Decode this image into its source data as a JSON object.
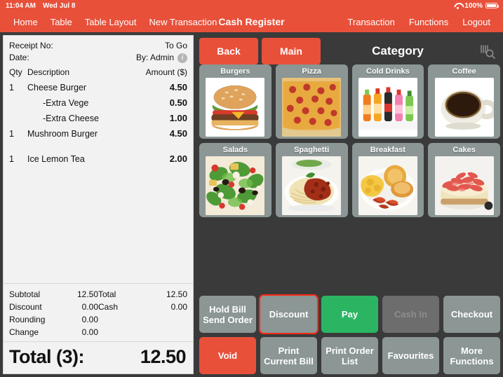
{
  "statusbar": {
    "time": "11:04 AM",
    "date": "Wed Jul 8",
    "battery_pct": "100%",
    "wifi_icon": "wifi-icon",
    "battery_icon": "battery-icon"
  },
  "navbar": {
    "left_items": [
      "Home",
      "Table",
      "Table Layout",
      "New Transaction"
    ],
    "title": "Cash Register",
    "right_items": [
      "Transaction",
      "Functions",
      "Logout"
    ]
  },
  "receipt": {
    "receipt_no_label": "Receipt No:",
    "receipt_no_value": "To Go",
    "date_label": "Date:",
    "date_value": "By: Admin",
    "info_icon": "info-icon",
    "col_qty": "Qty",
    "col_desc": "Description",
    "col_amount": "Amount ($)",
    "items": [
      {
        "qty": "1",
        "desc": "Cheese Burger",
        "amt": "4.50",
        "modifier": false,
        "spacer_after": false
      },
      {
        "qty": "",
        "desc": "-Extra Vege",
        "amt": "0.50",
        "modifier": true,
        "spacer_after": false
      },
      {
        "qty": "",
        "desc": "-Extra Cheese",
        "amt": "1.00",
        "modifier": true,
        "spacer_after": false
      },
      {
        "qty": "1",
        "desc": "Mushroom Burger",
        "amt": "4.50",
        "modifier": false,
        "spacer_after": true
      },
      {
        "qty": "1",
        "desc": "Ice Lemon Tea",
        "amt": "2.00",
        "modifier": false,
        "spacer_after": false
      }
    ],
    "totals_left": [
      {
        "label": "Subtotal",
        "value": "12.50"
      },
      {
        "label": "Discount",
        "value": "0.00"
      },
      {
        "label": "Rounding",
        "value": "0.00"
      },
      {
        "label": "Change",
        "value": "0.00"
      }
    ],
    "totals_right": [
      {
        "label": "Total",
        "value": "12.50"
      },
      {
        "label": "Cash",
        "value": "0.00"
      }
    ],
    "grand_label": "Total (3):",
    "grand_value": "12.50"
  },
  "toolbar": {
    "back_label": "Back",
    "main_label": "Main",
    "category_title": "Category",
    "scan_icon": "barcode-search-icon"
  },
  "categories": [
    {
      "label": "Burgers",
      "image": "burger"
    },
    {
      "label": "Pizza",
      "image": "pizza"
    },
    {
      "label": "Cold Drinks",
      "image": "cold-drinks"
    },
    {
      "label": "Coffee",
      "image": "coffee"
    },
    {
      "label": "Salads",
      "image": "salad"
    },
    {
      "label": "Spaghetti",
      "image": "spaghetti"
    },
    {
      "label": "Breakfast",
      "image": "breakfast"
    },
    {
      "label": "Cakes",
      "image": "cake"
    }
  ],
  "actions": [
    {
      "name": "hold-bill-send-order",
      "label": "Hold Bill\nSend Order",
      "style": "grey",
      "selected": false,
      "disabled": false
    },
    {
      "name": "discount",
      "label": "Discount",
      "style": "grey",
      "selected": true,
      "disabled": false
    },
    {
      "name": "pay",
      "label": "Pay",
      "style": "green",
      "selected": false,
      "disabled": false
    },
    {
      "name": "cash-in",
      "label": "Cash In",
      "style": "grey",
      "selected": false,
      "disabled": true
    },
    {
      "name": "checkout",
      "label": "Checkout",
      "style": "grey",
      "selected": false,
      "disabled": false
    },
    {
      "name": "void",
      "label": "Void",
      "style": "red",
      "selected": false,
      "disabled": false
    },
    {
      "name": "print-current-bill",
      "label": "Print\nCurrent Bill",
      "style": "grey",
      "selected": false,
      "disabled": false
    },
    {
      "name": "print-order-list",
      "label": "Print Order\nList",
      "style": "grey",
      "selected": false,
      "disabled": false
    },
    {
      "name": "favourites",
      "label": "Favourites",
      "style": "grey",
      "selected": false,
      "disabled": false
    },
    {
      "name": "more-functions",
      "label": "More\nFunctions",
      "style": "grey",
      "selected": false,
      "disabled": false
    }
  ],
  "colors": {
    "brand_red": "#e8503a",
    "pane_dark": "#3a3a3a",
    "tile_grey": "#8b9695",
    "pay_green": "#2bb563",
    "selected_outline": "#ff2a16",
    "receipt_bg": "#f2f2f2"
  }
}
